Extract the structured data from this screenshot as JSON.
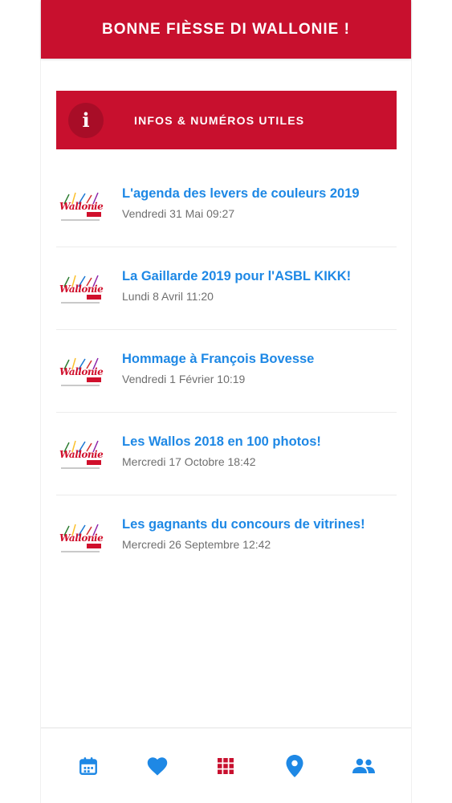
{
  "header": {
    "title": "BONNE FIÈSSE DI WALLONIE !"
  },
  "info_banner": {
    "icon": "info-icon",
    "glyph": "i",
    "label": "INFOS & NUMÉROS UTILES"
  },
  "news": [
    {
      "title": "L'agenda des levers de couleurs 2019",
      "date": "Vendredi 31 Mai 09:27",
      "logo_text": "Wallonie"
    },
    {
      "title": "La Gaillarde 2019 pour l'ASBL KIKK!",
      "date": "Lundi 8 Avril 11:20",
      "logo_text": "Wallonie"
    },
    {
      "title": "Hommage à François Bovesse",
      "date": "Vendredi 1 Février 10:19",
      "logo_text": "Wallonie"
    },
    {
      "title": "Les Wallos 2018 en 100 photos!",
      "date": "Mercredi 17 Octobre 18:42",
      "logo_text": "Wallonie"
    },
    {
      "title": "Les gagnants du concours de vitrines!",
      "date": "Mercredi 26 Septembre 12:42",
      "logo_text": "Wallonie"
    }
  ],
  "bottom_nav": [
    {
      "icon": "calendar-icon"
    },
    {
      "icon": "heart-icon"
    },
    {
      "icon": "grid-icon"
    },
    {
      "icon": "location-pin-icon"
    },
    {
      "icon": "people-icon"
    }
  ],
  "colors": {
    "brand_red": "#c8102e",
    "link_blue": "#1e88e5",
    "nav_blue": "#1e88e5",
    "nav_grid_red": "#c8102e",
    "date_gray": "#6f6f6f"
  }
}
